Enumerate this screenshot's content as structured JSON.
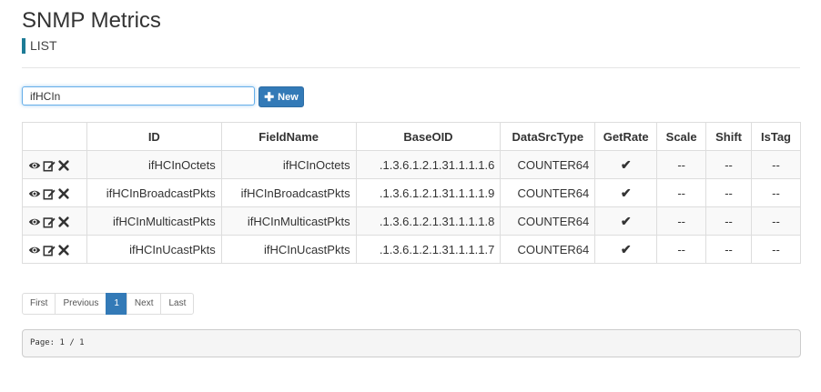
{
  "header": {
    "title": "SNMP Metrics",
    "subtitle": "LIST"
  },
  "toolbar": {
    "search_value": "ifHCIn",
    "new_label": "New"
  },
  "table": {
    "columns": [
      "",
      "ID",
      "FieldName",
      "BaseOID",
      "DataSrcType",
      "GetRate",
      "Scale",
      "Shift",
      "IsTag"
    ],
    "rows": [
      {
        "id": "ifHCInOctets",
        "fieldname": "ifHCInOctets",
        "baseoid": ".1.3.6.1.2.1.31.1.1.1.6",
        "datasrctype": "COUNTER64",
        "getrate": "✔",
        "scale": "--",
        "shift": "--",
        "istag": "--"
      },
      {
        "id": "ifHCInBroadcastPkts",
        "fieldname": "ifHCInBroadcastPkts",
        "baseoid": ".1.3.6.1.2.1.31.1.1.1.9",
        "datasrctype": "COUNTER64",
        "getrate": "✔",
        "scale": "--",
        "shift": "--",
        "istag": "--"
      },
      {
        "id": "ifHCInMulticastPkts",
        "fieldname": "ifHCInMulticastPkts",
        "baseoid": ".1.3.6.1.2.1.31.1.1.1.8",
        "datasrctype": "COUNTER64",
        "getrate": "✔",
        "scale": "--",
        "shift": "--",
        "istag": "--"
      },
      {
        "id": "ifHCInUcastPkts",
        "fieldname": "ifHCInUcastPkts",
        "baseoid": ".1.3.6.1.2.1.31.1.1.1.7",
        "datasrctype": "COUNTER64",
        "getrate": "✔",
        "scale": "--",
        "shift": "--",
        "istag": "--"
      }
    ],
    "row_actions": [
      "eye-icon",
      "edit-icon",
      "delete-icon"
    ]
  },
  "pagination": {
    "first": "First",
    "previous": "Previous",
    "current": "1",
    "next": "Next",
    "last": "Last"
  },
  "footer": {
    "page_info": "Page: 1 / 1"
  },
  "colors": {
    "accent": "#337ab7",
    "subtitle_bar": "#1d7b96"
  }
}
